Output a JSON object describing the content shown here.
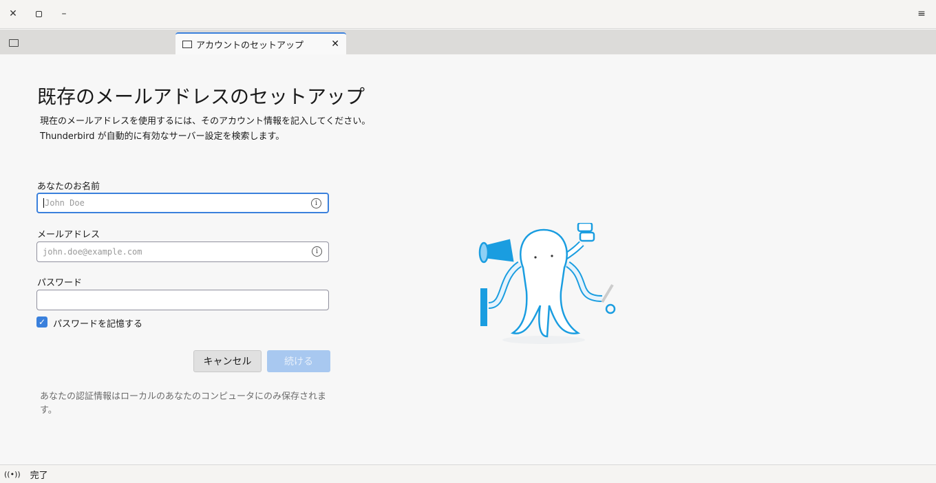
{
  "window": {
    "close_icon": "close-icon",
    "restore_icon": "restore-icon",
    "minimize_icon": "minimize-icon",
    "menu_icon": "hamburger-icon"
  },
  "tabs": [
    {
      "label": "アカウントのセットアップ",
      "icon": "mail-add-icon"
    }
  ],
  "page": {
    "title": "既存のメールアドレスのセットアップ",
    "desc_line1": "現在のメールアドレスを使用するには、そのアカウント情報を記入してください。",
    "desc_line2": "Thunderbird が自動的に有効なサーバー設定を検索します。"
  },
  "form": {
    "name_label": "あなたのお名前",
    "name_placeholder": "John Doe",
    "email_label": "メールアドレス",
    "email_placeholder": "john.doe@example.com",
    "password_label": "パスワード",
    "password_value": "",
    "remember_label": "パスワードを記憶する",
    "remember_checked": true,
    "cancel_label": "キャンセル",
    "continue_label": "続ける",
    "note": "あなたの認証情報はローカルのあなたのコンピュータにのみ保存されます。"
  },
  "status": {
    "text": "完了"
  },
  "colors": {
    "accent": "#3a80dc",
    "continue_disabled": "#a8c8f0"
  }
}
